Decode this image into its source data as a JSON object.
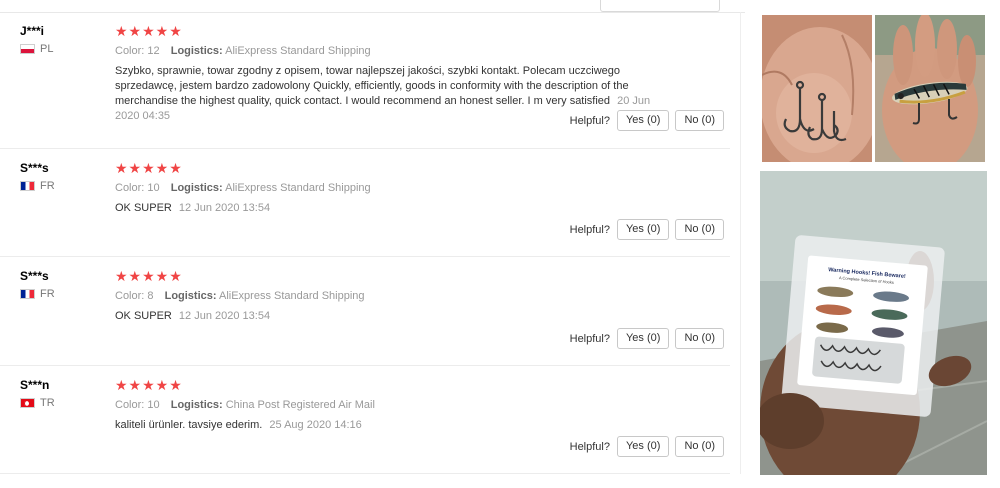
{
  "helpful_label": "Helpful?",
  "yes_label": "Yes (0)",
  "no_label": "No (0)",
  "color_label": "Color:",
  "logistics_label": "Logistics:",
  "rating_stars": "★★★★★",
  "reviews": [
    {
      "user": "J***i",
      "country": "PL",
      "rating": 5,
      "color_value": "12",
      "logistics_value": "AliExpress Standard Shipping",
      "text": "Szybko, sprawnie, towar zgodny z opisem, towar najlepszej jakości, szybki kontakt. Polecam uczciwego sprzedawcę, jestem bardzo zadowolony Quickly, efficiently, goods in conformity with the description of the merchandise the highest quality, quick contact. I would recommend an honest seller. I m very satisfied",
      "date": "20 Jun 2020 04:35"
    },
    {
      "user": "S***s",
      "country": "FR",
      "rating": 5,
      "color_value": "10",
      "logistics_value": "AliExpress Standard Shipping",
      "text": "OK SUPER",
      "date": "12 Jun 2020 13:54"
    },
    {
      "user": "S***s",
      "country": "FR",
      "rating": 5,
      "color_value": "8",
      "logistics_value": "AliExpress Standard Shipping",
      "text": "OK SUPER",
      "date": "12 Jun 2020 13:54"
    },
    {
      "user": "S***n",
      "country": "TR",
      "rating": 5,
      "color_value": "10",
      "logistics_value": "China Post Registered Air Mail",
      "text": "kaliteli ürünler. tavsiye ederim.",
      "date": "25 Aug 2020 14:16"
    }
  ],
  "box_label": {
    "title": "Warning Hooks! Fish Beware!",
    "subtitle": "A Complete Selection of Hooks"
  },
  "colors": {
    "star": "#f04545",
    "meta_text": "#999999",
    "border": "#ececec"
  }
}
